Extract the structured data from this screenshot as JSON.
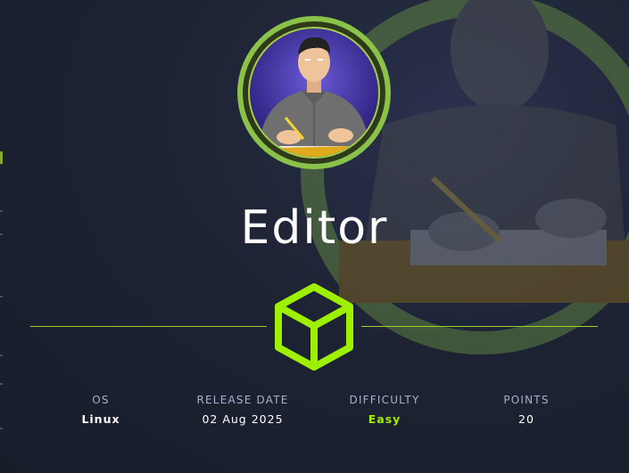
{
  "machine": {
    "name": "Editor"
  },
  "stats": {
    "os": {
      "label": "OS",
      "value": "Linux"
    },
    "release_date": {
      "label": "RELEASE DATE",
      "value": "02 Aug 2025"
    },
    "difficulty": {
      "label": "DIFFICULTY",
      "value": "Easy"
    },
    "points": {
      "label": "POINTS",
      "value": "20"
    }
  },
  "colors": {
    "background": "#1b2130",
    "accent_green": "#9fef00",
    "avatar_ring": "#8bc34a",
    "divider": "#9fcf2b",
    "label": "#a4b1cd"
  },
  "icons": {
    "avatar": "editor-character-avatar",
    "difficulty_symbol": "cube-icon"
  }
}
